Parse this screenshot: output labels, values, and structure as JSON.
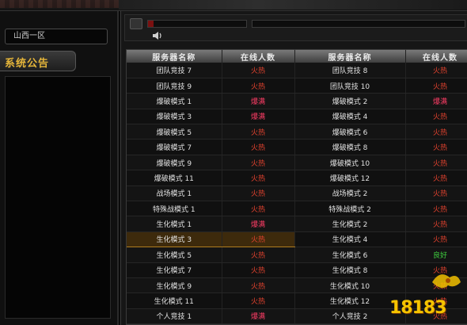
{
  "left": {
    "server_value": "山西一区",
    "notice_title": "系统公告"
  },
  "media": {
    "progress": 0.06
  },
  "table": {
    "headers": [
      "服务器名称",
      "在线人数",
      "服务器名称",
      "在线人数"
    ],
    "rows": [
      {
        "n1": "团队竞技 7",
        "s1": "火热",
        "t1": "hot",
        "n2": "团队竞技 8",
        "s2": "火热",
        "t2": "hot"
      },
      {
        "n1": "团队竞技 9",
        "s1": "火热",
        "t1": "hot",
        "n2": "团队竞技 10",
        "s2": "火热",
        "t2": "hot"
      },
      {
        "n1": "爆破模式 1",
        "s1": "爆满",
        "t1": "full",
        "n2": "爆破模式 2",
        "s2": "爆满",
        "t2": "full"
      },
      {
        "n1": "爆破模式 3",
        "s1": "爆满",
        "t1": "full",
        "n2": "爆破模式 4",
        "s2": "火热",
        "t2": "hot"
      },
      {
        "n1": "爆破模式 5",
        "s1": "火热",
        "t1": "hot",
        "n2": "爆破模式 6",
        "s2": "火热",
        "t2": "hot"
      },
      {
        "n1": "爆破模式 7",
        "s1": "火热",
        "t1": "hot",
        "n2": "爆破模式 8",
        "s2": "火热",
        "t2": "hot"
      },
      {
        "n1": "爆破模式 9",
        "s1": "火热",
        "t1": "hot",
        "n2": "爆破模式 10",
        "s2": "火热",
        "t2": "hot"
      },
      {
        "n1": "爆破模式 11",
        "s1": "火热",
        "t1": "hot",
        "n2": "爆破模式 12",
        "s2": "火热",
        "t2": "hot"
      },
      {
        "n1": "战场模式 1",
        "s1": "火热",
        "t1": "hot",
        "n2": "战场模式 2",
        "s2": "火热",
        "t2": "hot"
      },
      {
        "n1": "特殊战模式 1",
        "s1": "火热",
        "t1": "hot",
        "n2": "特殊战模式 2",
        "s2": "火热",
        "t2": "hot"
      },
      {
        "n1": "生化模式 1",
        "s1": "爆满",
        "t1": "full",
        "n2": "生化模式 2",
        "s2": "火热",
        "t2": "hot"
      },
      {
        "n1": "生化模式 3",
        "s1": "火热",
        "t1": "hot",
        "n2": "生化模式 4",
        "s2": "火热",
        "t2": "hot",
        "selected": true
      },
      {
        "n1": "生化模式 5",
        "s1": "火热",
        "t1": "hot",
        "n2": "生化模式 6",
        "s2": "良好",
        "t2": "good"
      },
      {
        "n1": "生化模式 7",
        "s1": "火热",
        "t1": "hot",
        "n2": "生化模式 8",
        "s2": "火热",
        "t2": "hot"
      },
      {
        "n1": "生化模式 9",
        "s1": "火热",
        "t1": "hot",
        "n2": "生化模式 10",
        "s2": "火热",
        "t2": "hot"
      },
      {
        "n1": "生化模式 11",
        "s1": "火热",
        "t1": "hot",
        "n2": "生化模式 12",
        "s2": "火热",
        "t2": "hot"
      },
      {
        "n1": "个人竞技 1",
        "s1": "爆满",
        "t1": "full",
        "n2": "个人竞技 2",
        "s2": "火热",
        "t2": "hot"
      }
    ]
  },
  "watermark": {
    "text": "18183"
  },
  "colors": {
    "hot": "#e2422e",
    "full": "#ff3d66",
    "good": "#3fd03f",
    "accent": "#e6b63a"
  }
}
